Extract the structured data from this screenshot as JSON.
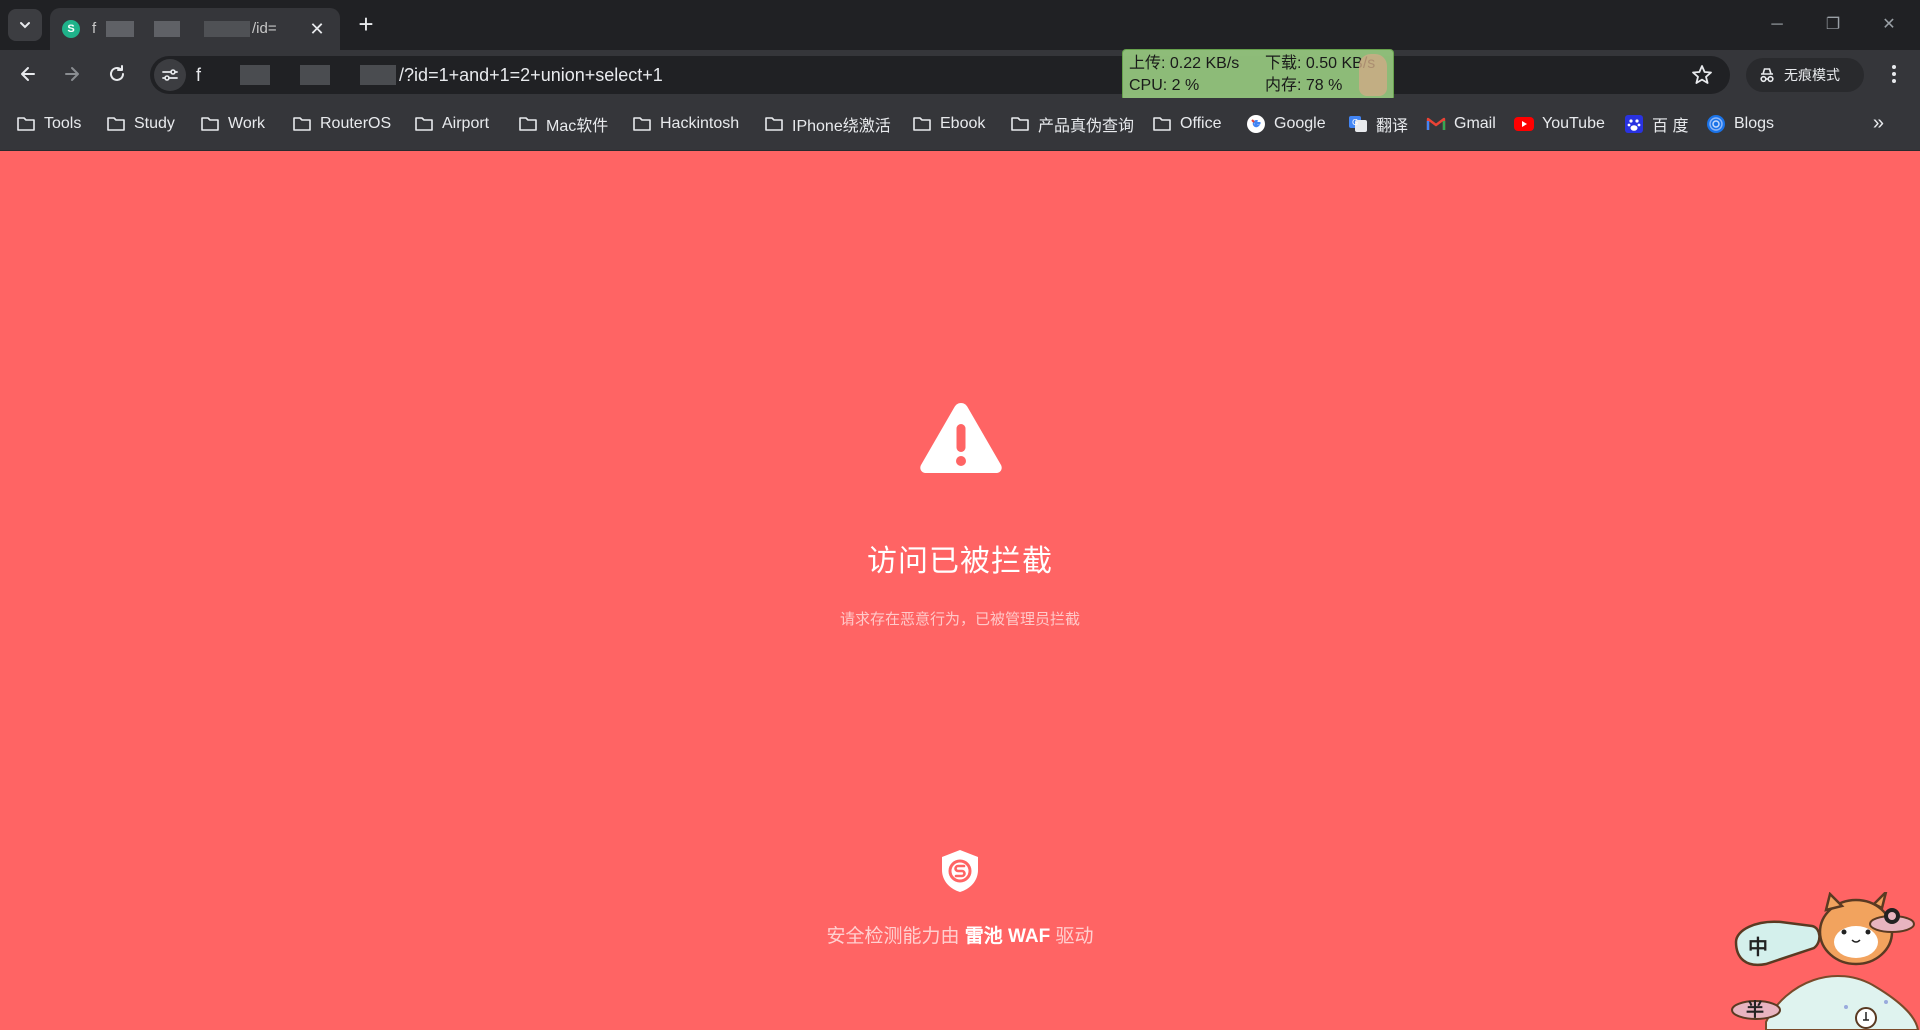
{
  "tab": {
    "title_fragment_1": "f",
    "title_fragment_2": "/id="
  },
  "toolbar": {
    "url_prefix": "f",
    "url_suffix": "/?id=1+and+1=2+union+select+1",
    "incognito_label": "无痕模式"
  },
  "monitor": {
    "upload": "上传: 0.22 KB/s",
    "download": "下载: 0.50 KB/s",
    "cpu": "CPU: 2 %",
    "memory": "内存: 78 %"
  },
  "bookmarks": [
    {
      "label": "Tools",
      "icon": "folder-icon"
    },
    {
      "label": "Study",
      "icon": "folder-icon"
    },
    {
      "label": "Work",
      "icon": "folder-icon"
    },
    {
      "label": "RouterOS",
      "icon": "folder-icon"
    },
    {
      "label": "Airport",
      "icon": "folder-icon"
    },
    {
      "label": "Mac软件",
      "icon": "folder-icon"
    },
    {
      "label": "Hackintosh",
      "icon": "folder-icon"
    },
    {
      "label": "IPhone绕激活",
      "icon": "folder-icon"
    },
    {
      "label": "Ebook",
      "icon": "folder-icon"
    },
    {
      "label": "产品真伪查询",
      "icon": "folder-icon"
    },
    {
      "label": "Office",
      "icon": "folder-icon"
    },
    {
      "label": "Google",
      "icon": "google-icon"
    },
    {
      "label": "翻译",
      "icon": "translate-icon"
    },
    {
      "label": "Gmail",
      "icon": "gmail-icon"
    },
    {
      "label": "YouTube",
      "icon": "youtube-icon"
    },
    {
      "label": "百 度",
      "icon": "baidu-icon"
    },
    {
      "label": "Blogs",
      "icon": "blogs-icon"
    }
  ],
  "page": {
    "title": "访问已被拦截",
    "subtitle": "请求存在恶意行为，已被管理员拦截",
    "powered_prefix": "安全检测能力由",
    "powered_brand": "雷池 WAF",
    "powered_suffix": "驱动"
  },
  "mascot": {
    "badge_1": "中",
    "badge_2": "半"
  },
  "colors": {
    "page_background": "#ff6464",
    "chrome_dark": "#202124",
    "chrome_toolbar": "#35363a",
    "monitor_green": "#93c47d"
  }
}
